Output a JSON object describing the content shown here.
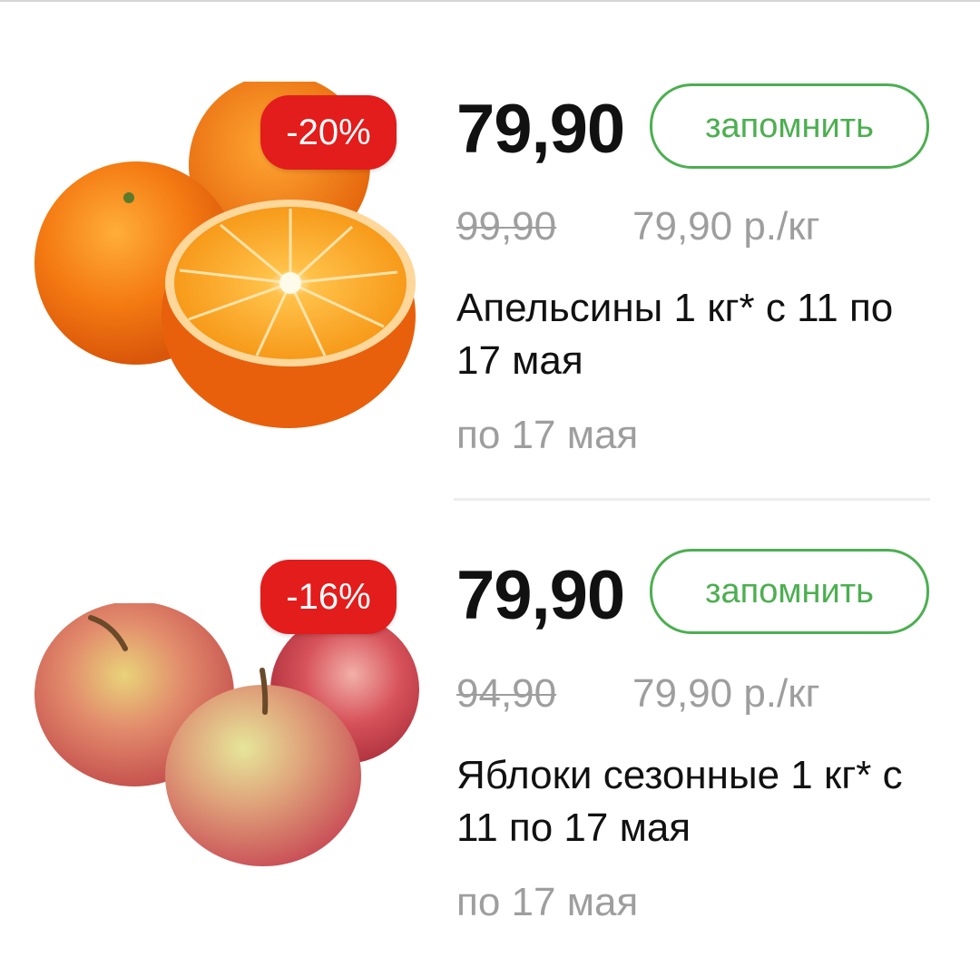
{
  "products": [
    {
      "discount": "-20%",
      "price": "79,90",
      "remember_label": "запомнить",
      "old_price": "99,90",
      "unit_price": "79,90 р./кг",
      "title": "Апельсины 1 кг* с 11 по 17 мая",
      "valid_until": "по 17 мая"
    },
    {
      "discount": "-16%",
      "price": "79,90",
      "remember_label": "запомнить",
      "old_price": "94,90",
      "unit_price": "79,90 р./кг",
      "title": "Яблоки сезонные 1 кг* с 11 по 17 мая",
      "valid_until": "по 17 мая"
    }
  ],
  "colors": {
    "accent": "#4caf50",
    "badge": "#e31c1c",
    "muted_text": "#9e9e9e"
  }
}
